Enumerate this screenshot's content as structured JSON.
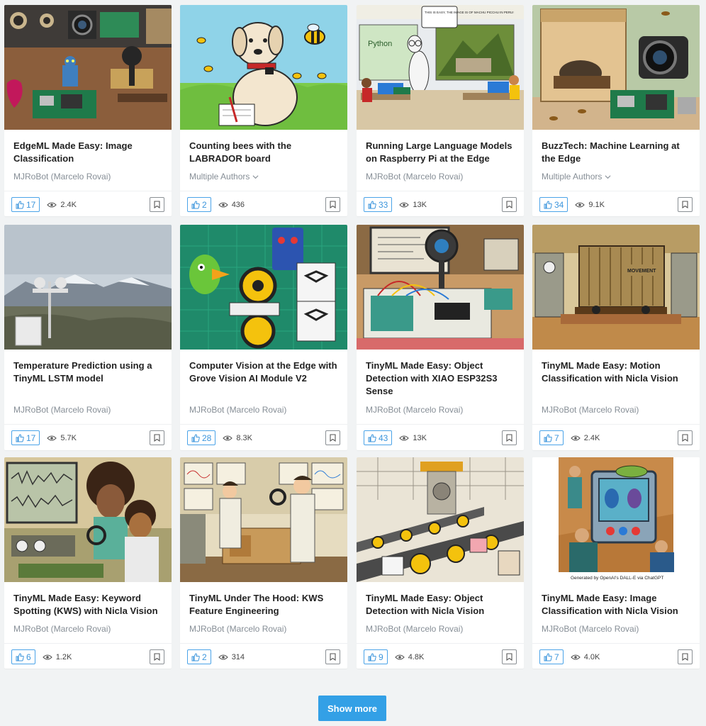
{
  "cards": [
    {
      "title": "EdgeML Made Easy: Image Classification",
      "author": "MJRoBot (Marcelo Rovai)",
      "likes": "17",
      "views": "2.4K",
      "multi": false,
      "image": "edgeml-image",
      "image_caption": ""
    },
    {
      "title": "Counting bees with the LABRADOR board",
      "author": "Multiple Authors",
      "likes": "2",
      "views": "436",
      "multi": true,
      "image": "dog-bees-image",
      "image_caption": ""
    },
    {
      "title": "Running Large Language Models on Raspberry Pi at the Edge",
      "author": "MJRoBot (Marcelo Rovai)",
      "likes": "33",
      "views": "13K",
      "multi": false,
      "image": "llama-classroom-image",
      "image_caption": "",
      "speech_bubble": "THIS IS EASY, THE IMAGE IS OF MACHU PICCHU IN PERU!",
      "board_label": "Python"
    },
    {
      "title": "BuzzTech: Machine Learning at the Edge",
      "author": "Multiple Authors",
      "likes": "34",
      "views": "9.1K",
      "multi": true,
      "image": "beehive-camera-image",
      "image_caption": ""
    },
    {
      "title": "Temperature Prediction using a TinyML LSTM model",
      "author": "MJRoBot (Marcelo Rovai)",
      "likes": "17",
      "views": "5.7K",
      "multi": false,
      "image": "weather-station-image",
      "image_caption": ""
    },
    {
      "title": "Computer Vision at the Edge with Grove Vision AI Module V2",
      "author": "MJRoBot (Marcelo Rovai)",
      "likes": "28",
      "views": "8.3K",
      "multi": false,
      "image": "robots-toys-image",
      "image_caption": ""
    },
    {
      "title": "TinyML Made Easy: Object Detection with XIAO ESP32S3 Sense",
      "author": "MJRoBot (Marcelo Rovai)",
      "likes": "43",
      "views": "13K",
      "multi": false,
      "image": "camera-breadboard-image",
      "image_caption": ""
    },
    {
      "title": "TinyML Made Easy: Motion Classification with Nicla Vision",
      "author": "MJRoBot (Marcelo Rovai)",
      "likes": "7",
      "views": "2.4K",
      "multi": false,
      "image": "container-lab-image",
      "image_caption": "",
      "container_label": "MOVEMENT"
    },
    {
      "title": "TinyML Made Easy: Keyword Spotting (KWS) with Nicla Vision",
      "author": "MJRoBot (Marcelo Rovai)",
      "likes": "6",
      "views": "1.2K",
      "multi": false,
      "image": "scientists-audio-image",
      "image_caption": ""
    },
    {
      "title": "TinyML Under The Hood: KWS Feature Engineering",
      "author": "MJRoBot (Marcelo Rovai)",
      "likes": "2",
      "views": "314",
      "multi": false,
      "image": "scientists-lab-image",
      "image_caption": ""
    },
    {
      "title": "TinyML Made Easy: Object Detection with Nicla Vision",
      "author": "MJRoBot (Marcelo Rovai)",
      "likes": "9",
      "views": "4.8K",
      "multi": false,
      "image": "factory-conveyor-image",
      "image_caption": ""
    },
    {
      "title": "TinyML Made Easy: Image Classification with Nicla Vision",
      "author": "MJRoBot (Marcelo Rovai)",
      "likes": "7",
      "views": "4.0K",
      "multi": false,
      "image": "retro-device-image",
      "image_caption": "Generated by OpenAI's DALL-E via ChatGPT"
    }
  ],
  "show_more_label": "Show more",
  "icons": {
    "like": "thumbs-up-icon",
    "views": "eye-icon",
    "bookmark": "bookmark-icon",
    "authors_dropdown": "chevron-down-icon"
  },
  "colors": {
    "accent": "#33a0e6",
    "like_border": "#4aa3e8",
    "page_bg": "#f1f3f4"
  }
}
